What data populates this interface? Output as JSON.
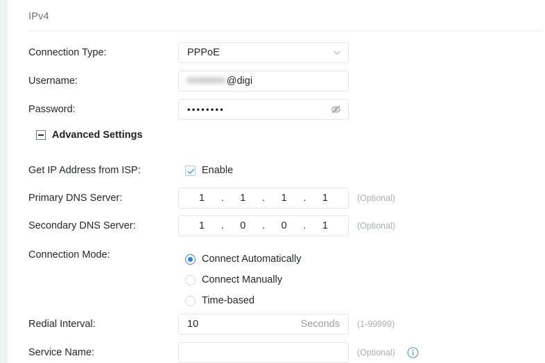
{
  "section": {
    "title": "IPv4"
  },
  "rows": {
    "connection_type": {
      "label": "Connection Type:",
      "value": "PPPoE",
      "icon": "chevron-down-icon"
    },
    "username": {
      "label": "Username:",
      "redacted": "••••••••••",
      "value_suffix": "@digi"
    },
    "password": {
      "label": "Password:",
      "value": "••••••••",
      "icon": "eye-off-icon"
    },
    "advanced_settings": {
      "label": "Advanced Settings",
      "icon": "collapse-minus-icon",
      "expanded": true
    },
    "get_ip_from_isp": {
      "label": "Get IP Address from ISP:",
      "checkbox_label": "Enable",
      "checked": true
    },
    "primary_dns": {
      "label": "Primary DNS Server:",
      "octets": [
        "1",
        "1",
        "1",
        "1"
      ],
      "separator": ".",
      "hint": "(Optional)"
    },
    "secondary_dns": {
      "label": "Secondary DNS Server:",
      "octets": [
        "1",
        "0",
        "0",
        "1"
      ],
      "separator": ".",
      "hint": "(Optional)"
    },
    "connection_mode": {
      "label": "Connection Mode:",
      "options": [
        {
          "label": "Connect Automatically",
          "selected": true
        },
        {
          "label": "Connect Manually",
          "selected": false
        },
        {
          "label": "Time-based",
          "selected": false
        }
      ]
    },
    "redial_interval": {
      "label": "Redial Interval:",
      "value": "10",
      "unit": "Seconds",
      "hint": "(1-99999)"
    },
    "service_name": {
      "label": "Service Name:",
      "value": "",
      "hint": "(Optional)",
      "icon": "info-circle-icon"
    }
  },
  "colors": {
    "accent": "#2f84d8",
    "text": "#23282b",
    "muted": "#a9b0b3",
    "border": "#e3e6e7",
    "rail": "#f0f2f2"
  }
}
